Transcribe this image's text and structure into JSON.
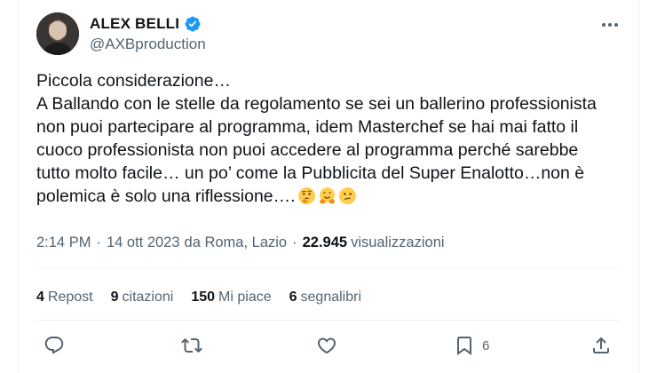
{
  "author": {
    "display_name": "ALEX BELLI",
    "handle": "@AXBproduction",
    "verified": true,
    "avatar": "profile-photo"
  },
  "tweet": {
    "text": "Piccola considerazione…\nA Ballando con le stelle da regolamento se sei un ballerino professionista\nnon puoi partecipare al programma, idem Masterchef se hai mai fatto il\ncuoco professionista non puoi accedere al programma perché sarebbe\ntutto molto facile… un po’ come la Pubblicita del Super Enalotto…non è\npolemica è solo una riflessione….",
    "emojis": [
      "thinking-face-emoji",
      "hugging-face-emoji",
      "confused-face-emoji"
    ]
  },
  "meta": {
    "time": "2:14 PM",
    "date": "14 ott 2023",
    "location": "da Roma, Lazio",
    "views_count": "22.945",
    "views_label": "visualizzazioni"
  },
  "stats": {
    "reposts_count": "4",
    "reposts_label": "Repost",
    "quotes_count": "9",
    "quotes_label": "citazioni",
    "likes_count": "150",
    "likes_label": "Mi piace",
    "bookmarks_count": "6",
    "bookmarks_label": "segnalibri"
  },
  "actions": {
    "reply": "reply-icon",
    "repost": "repost-icon",
    "like": "heart-icon",
    "bookmark": "bookmark-icon",
    "bookmark_count": "6",
    "share": "share-icon"
  },
  "colors": {
    "text": "#0f1419",
    "secondary": "#536471",
    "verified": "#1d9bf0",
    "divider": "#eff3f4"
  }
}
